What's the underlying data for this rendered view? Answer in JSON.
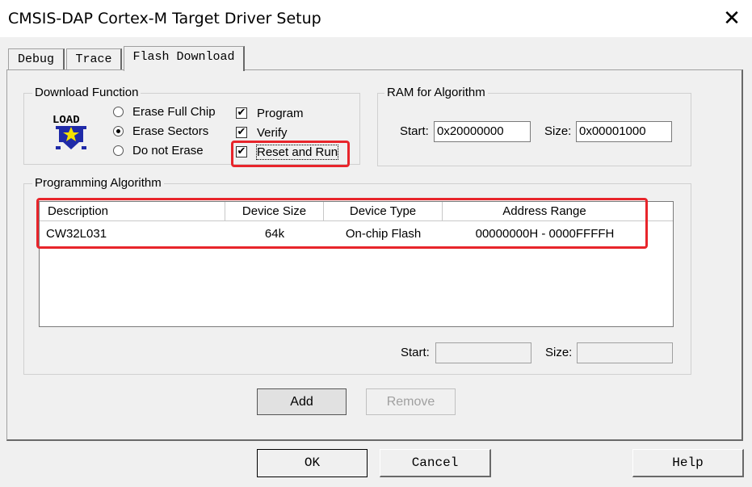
{
  "window": {
    "title": "CMSIS-DAP Cortex-M Target Driver Setup",
    "close_glyph": "✕"
  },
  "tabs": [
    {
      "label": "Debug"
    },
    {
      "label": "Trace"
    },
    {
      "label": "Flash Download",
      "active": true
    }
  ],
  "download_function": {
    "legend": "Download Function",
    "load_icon_text": "LOAD",
    "radios": [
      {
        "label": "Erase Full Chip",
        "selected": false
      },
      {
        "label": "Erase Sectors",
        "selected": true
      },
      {
        "label": "Do not Erase",
        "selected": false
      }
    ],
    "checkboxes": [
      {
        "label": "Program",
        "checked": true
      },
      {
        "label": "Verify",
        "checked": true
      },
      {
        "label": "Reset and Run",
        "checked": true
      }
    ]
  },
  "ram": {
    "legend": "RAM for Algorithm",
    "start_label": "Start:",
    "start_value": "0x20000000",
    "size_label": "Size:",
    "size_value": "0x00001000"
  },
  "programming_algorithm": {
    "legend": "Programming Algorithm",
    "columns": [
      "Description",
      "Device Size",
      "Device Type",
      "Address Range"
    ],
    "rows": [
      {
        "description": "CW32L031",
        "device_size": "64k",
        "device_type": "On-chip Flash",
        "address_range": "00000000H - 0000FFFFH"
      }
    ],
    "start_label": "Start:",
    "start_value": "",
    "size_label": "Size:",
    "size_value": ""
  },
  "buttons": {
    "add": "Add",
    "remove": "Remove",
    "ok": "OK",
    "cancel": "Cancel",
    "help": "Help"
  },
  "check_glyph": "✔",
  "colors": {
    "highlight": "#e8252b",
    "dialog_bg": "#f0f0f0"
  }
}
